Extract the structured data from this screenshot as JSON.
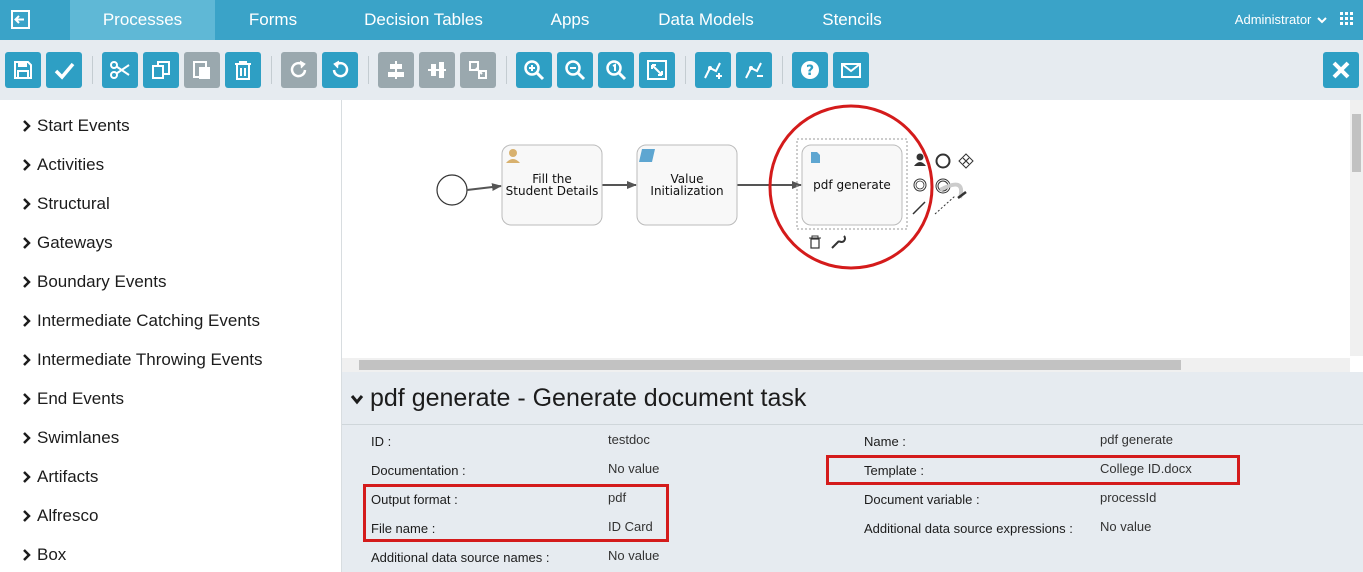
{
  "nav": {
    "tabs": [
      "Processes",
      "Forms",
      "Decision Tables",
      "Apps",
      "Data Models",
      "Stencils"
    ],
    "user": "Administrator"
  },
  "toolbar": {
    "buttons": [
      "save",
      "validate",
      "cut",
      "copy",
      "paste",
      "delete",
      "redo",
      "undo",
      "align-horizontal",
      "align-vertical",
      "same-size",
      "zoom-in",
      "zoom-out",
      "zoom-actual",
      "zoom-fit",
      "bendpoint-add",
      "bendpoint-remove",
      "help",
      "feedback",
      "close"
    ]
  },
  "palette": {
    "items": [
      "Start Events",
      "Activities",
      "Structural",
      "Gateways",
      "Boundary Events",
      "Intermediate Catching Events",
      "Intermediate Throwing Events",
      "End Events",
      "Swimlanes",
      "Artifacts",
      "Alfresco",
      "Box"
    ]
  },
  "diagram": {
    "tasks": [
      {
        "line1": "Fill the",
        "line2": "Student Details",
        "type": "user-task"
      },
      {
        "line1": "Value",
        "line2": "Initialization",
        "type": "script-task"
      },
      {
        "line1": "pdf generate",
        "line2": "",
        "type": "document-task"
      }
    ]
  },
  "properties": {
    "title": "pdf generate - Generate document task",
    "left": [
      {
        "label": "ID :",
        "value": "testdoc"
      },
      {
        "label": "Documentation :",
        "value": "No value"
      },
      {
        "label": "Output format :",
        "value": "pdf"
      },
      {
        "label": "File name :",
        "value": "ID Card"
      },
      {
        "label": "Additional data source names :",
        "value": "No value"
      }
    ],
    "right": [
      {
        "label": "Name :",
        "value": "pdf generate"
      },
      {
        "label": "Template :",
        "value": "College ID.docx"
      },
      {
        "label": "Document variable :",
        "value": "processId"
      },
      {
        "label": "Additional data source expressions :",
        "value": "No value"
      }
    ]
  },
  "colors": {
    "accent": "#3aa3c8",
    "highlight": "#d41b1b",
    "toolbar_bg": "#e6ebf0"
  }
}
